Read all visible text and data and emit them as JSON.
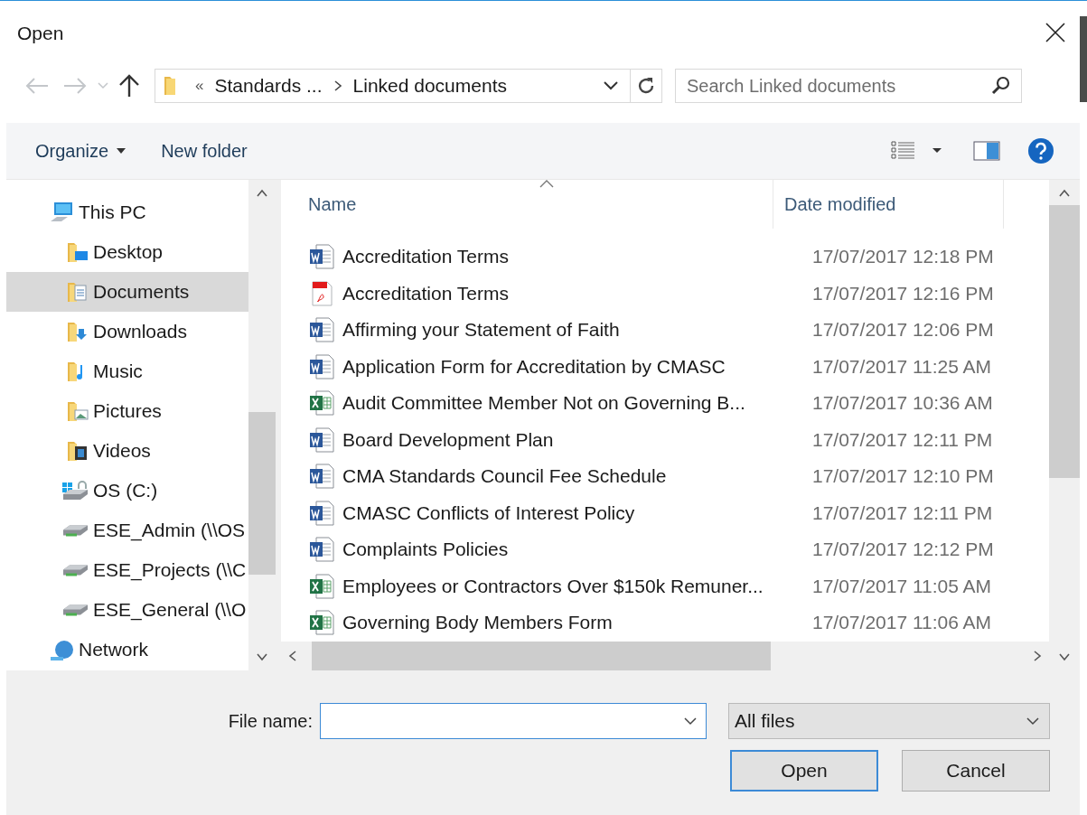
{
  "window": {
    "title": "Open"
  },
  "address_bar": {
    "segments": [
      "«",
      "Standards ...",
      "Linked documents"
    ]
  },
  "search": {
    "placeholder": "Search Linked documents"
  },
  "toolbar": {
    "buttons": [
      "Organize",
      "New folder"
    ]
  },
  "sidebar": {
    "items": [
      {
        "label": "This PC",
        "kind": "pc",
        "selected": false,
        "children": [
          {
            "label": "Desktop",
            "kind": "desktop",
            "selected": false
          },
          {
            "label": "Documents",
            "kind": "documents",
            "selected": true
          },
          {
            "label": "Downloads",
            "kind": "downloads",
            "selected": false
          },
          {
            "label": "Music",
            "kind": "music",
            "selected": false
          },
          {
            "label": "Pictures",
            "kind": "pictures",
            "selected": false
          },
          {
            "label": "Videos",
            "kind": "videos",
            "selected": false
          },
          {
            "label": "OS (C:)",
            "kind": "drive",
            "selected": false
          },
          {
            "label": "ESE_Admin (\\\\OS",
            "kind": "netdrive",
            "selected": false
          },
          {
            "label": "ESE_Projects (\\\\C",
            "kind": "netdrive",
            "selected": false
          },
          {
            "label": "ESE_General (\\\\O",
            "kind": "netdrive",
            "selected": false
          }
        ]
      },
      {
        "label": "Network",
        "kind": "network",
        "selected": false
      }
    ]
  },
  "table": {
    "columns": [
      "Name",
      "Date modified"
    ],
    "rows": [
      {
        "name": "Accreditation Terms",
        "kind": "word",
        "date": "17/07/2017 12:18 PM"
      },
      {
        "name": "Accreditation Terms",
        "kind": "pdf",
        "date": "17/07/2017 12:16 PM"
      },
      {
        "name": "Affirming your Statement of Faith",
        "kind": "word",
        "date": "17/07/2017 12:06 PM"
      },
      {
        "name": "Application Form for Accreditation by CMASC",
        "kind": "word",
        "date": "17/07/2017 11:25 AM"
      },
      {
        "name": "Audit Committee Member Not on Governing B...",
        "kind": "excel",
        "date": "17/07/2017 10:36 AM"
      },
      {
        "name": "Board Development Plan",
        "kind": "word",
        "date": "17/07/2017 12:11 PM"
      },
      {
        "name": "CMA Standards Council Fee Schedule",
        "kind": "word",
        "date": "17/07/2017 12:10 PM"
      },
      {
        "name": "CMASC Conflicts of Interest Policy",
        "kind": "word",
        "date": "17/07/2017 12:11 PM"
      },
      {
        "name": "Complaints Policies",
        "kind": "word",
        "date": "17/07/2017 12:12 PM"
      },
      {
        "name": "Employees or Contractors Over $150k Remuner...",
        "kind": "excel",
        "date": "17/07/2017 11:05 AM"
      },
      {
        "name": "Governing Body Members Form",
        "kind": "excel",
        "date": "17/07/2017 11:06 AM"
      }
    ]
  },
  "file_name": {
    "label": "File name:"
  },
  "file_type": {
    "value": "All files"
  },
  "buttons": [
    "Open",
    "Cancel"
  ]
}
